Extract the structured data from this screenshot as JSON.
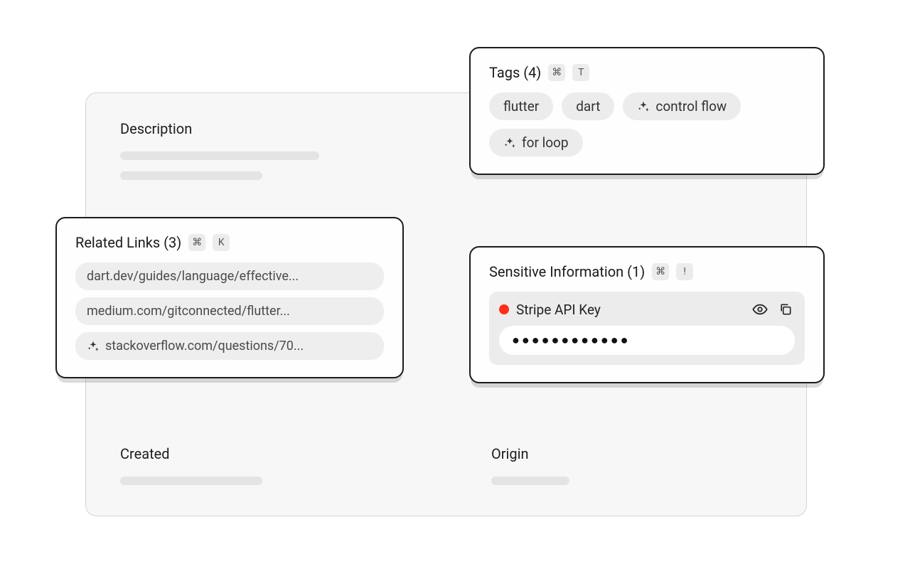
{
  "description": {
    "title": "Description"
  },
  "created": {
    "title": "Created"
  },
  "origin": {
    "title": "Origin"
  },
  "relatedLinks": {
    "title": "Related Links (3)",
    "shortcut": {
      "mod": "⌘",
      "key": "K"
    },
    "items": [
      {
        "label": "dart.dev/guides/language/effective...",
        "ai": false
      },
      {
        "label": "medium.com/gitconnected/flutter...",
        "ai": false
      },
      {
        "label": "stackoverflow.com/questions/70...",
        "ai": true
      }
    ]
  },
  "tags": {
    "title": "Tags (4)",
    "shortcut": {
      "mod": "⌘",
      "key": "T"
    },
    "items": [
      {
        "label": "flutter",
        "ai": false
      },
      {
        "label": "dart",
        "ai": false
      },
      {
        "label": "control flow",
        "ai": true
      },
      {
        "label": "for loop",
        "ai": true
      }
    ]
  },
  "sensitive": {
    "title": "Sensitive Information (1)",
    "shortcut": {
      "mod": "⌘",
      "key": "!"
    },
    "item": {
      "name": "Stripe API Key",
      "masked": "●●●●●●●●●●●●"
    }
  }
}
